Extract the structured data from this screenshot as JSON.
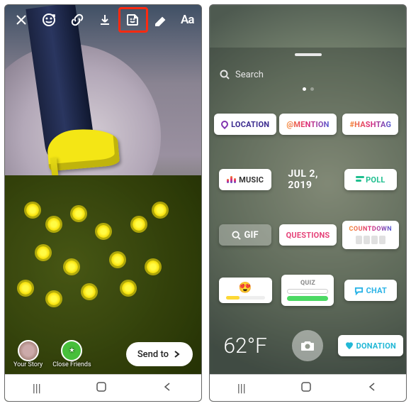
{
  "left": {
    "toolbar": {
      "text_tool": "Aa"
    },
    "bottom": {
      "your_story": "Your Story",
      "close_friends": "Close Friends",
      "send_to": "Send to"
    }
  },
  "right": {
    "search_placeholder": "Search",
    "stickers": {
      "location": "LOCATION",
      "mention": "@MENTION",
      "hashtag": "#HASHTAG",
      "music": "MUSIC",
      "date": "JUL 2, 2019",
      "poll": "POLL",
      "gif": "GIF",
      "questions": "QUESTIONS",
      "countdown": "COUNTDOWN",
      "quiz": "QUIZ",
      "chat": "CHAT",
      "temperature": "62°F",
      "donation": "DONATION"
    }
  }
}
